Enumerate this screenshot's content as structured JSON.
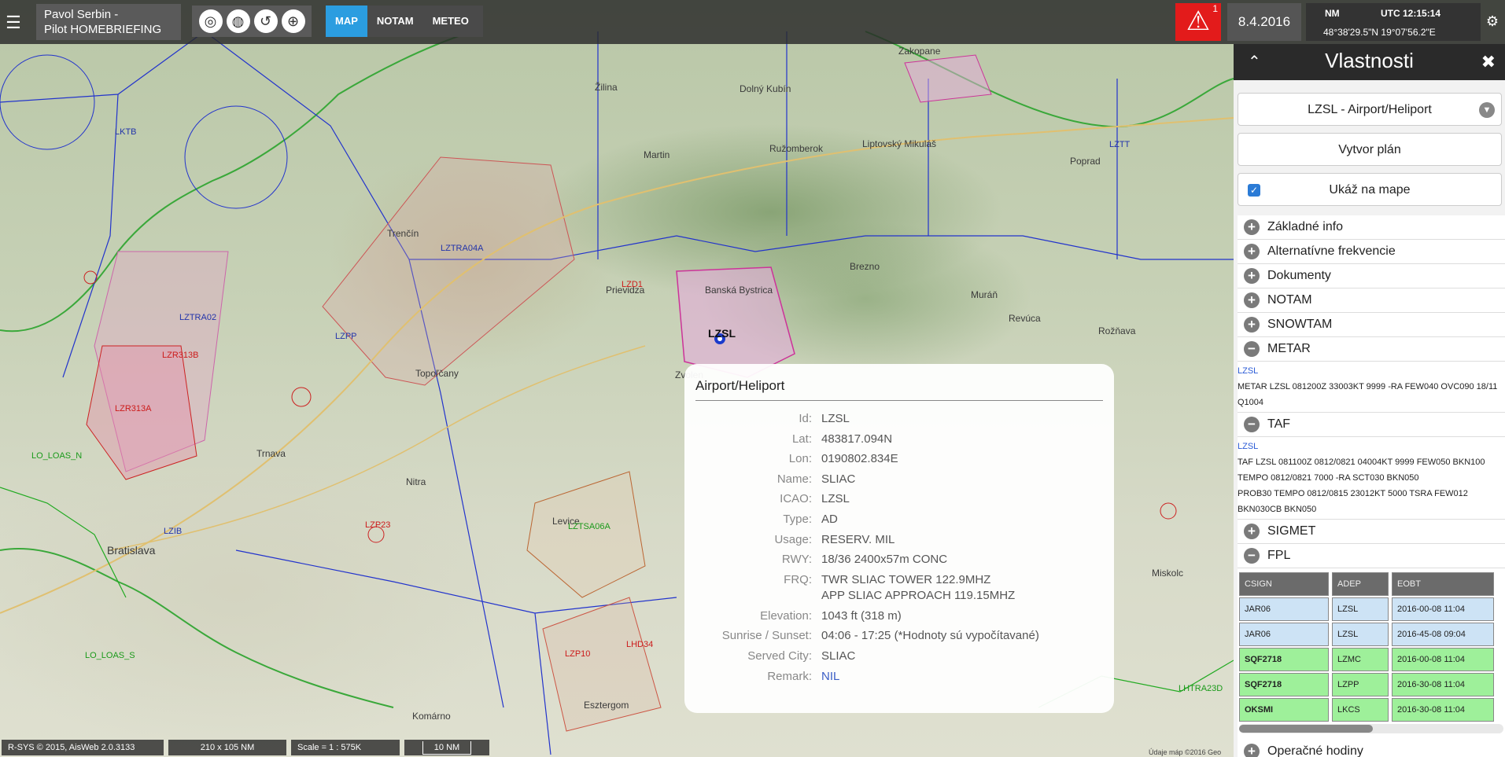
{
  "header": {
    "user_line1": "Pavol  Serbin -",
    "user_line2": "Pilot HOMEBRIEFING",
    "tool_icons": [
      "compass-icon",
      "globe-icon",
      "rotate-icon",
      "globe-grid-icon"
    ],
    "tabs": [
      {
        "label": "MAP",
        "active": true
      },
      {
        "label": "NOTAM",
        "active": false
      },
      {
        "label": "METEO",
        "active": false
      }
    ],
    "alert_count": "1",
    "date": "8.4.2016",
    "unit": "NM",
    "utc": "UTC 12:15:14",
    "latlon": "48°38'29.5\"N 19°07'56.2\"E"
  },
  "popup": {
    "title": "Airport/Heliport",
    "rows": [
      {
        "label": "Id:",
        "value": "LZSL"
      },
      {
        "label": "Lat:",
        "value": "483817.094N"
      },
      {
        "label": "Lon:",
        "value": "0190802.834E"
      },
      {
        "label": "Name:",
        "value": "SLIAC"
      },
      {
        "label": "ICAO:",
        "value": "LZSL"
      },
      {
        "label": "Type:",
        "value": "AD"
      },
      {
        "label": "Usage:",
        "value": "RESERV. MIL"
      },
      {
        "label": "RWY:",
        "value": "18/36 2400x57m CONC"
      },
      {
        "label": "FRQ:",
        "value": "TWR SLIAC TOWER 122.9MHZ",
        "value2": "APP SLIAC APPROACH 119.15MHZ"
      },
      {
        "label": "Elevation:",
        "value": "1043 ft (318 m)"
      },
      {
        "label": "Sunrise / Sunset:",
        "value": "04:06 - 17:25 (*Hodnoty sú vypočítavané)"
      },
      {
        "label": "Served City:",
        "value": "SLIAC"
      },
      {
        "label": "Remark:",
        "value": "NIL"
      }
    ]
  },
  "panel": {
    "title": "Vlastnosti",
    "airport_select": "LZSL - Airport/Heliport",
    "plan_button": "Vytvor plán",
    "show_on_map": "Ukáž na mape",
    "sections": {
      "zakladne": "Základné info",
      "alt_freq": "Alternatívne frekvencie",
      "dokumenty": "Dokumenty",
      "notam": "NOTAM",
      "snowtam": "SNOWTAM",
      "metar": "METAR",
      "taf": "TAF",
      "sigmet": "SIGMET",
      "fpl": "FPL",
      "operacne": "Operačné hodiny"
    },
    "metar": {
      "station": "LZSL",
      "line1": "METAR LZSL 081200Z 33003KT 9999 -RA FEW040 OVC090 18/11",
      "line2": "Q1004"
    },
    "taf": {
      "station": "LZSL",
      "line1": "TAF LZSL 081100Z 0812/0821 04004KT 9999 FEW050 BKN100",
      "line2": "TEMPO 0812/0821 7000 -RA SCT030 BKN050",
      "line3": "PROB30 TEMPO 0812/0815 23012KT 5000 TSRA FEW012",
      "line4": "BKN030CB BKN050"
    },
    "fpl": {
      "headers": [
        "CSIGN",
        "ADEP",
        "EOBT"
      ],
      "rows": [
        {
          "csign": "JAR06",
          "adep": "LZSL",
          "eobt": "2016-00-08 11:04",
          "color": "blue"
        },
        {
          "csign": "JAR06",
          "adep": "LZSL",
          "eobt": "2016-45-08 09:04",
          "color": "blue"
        },
        {
          "csign": "SQF2718",
          "adep": "LZMC",
          "eobt": "2016-00-08 11:04",
          "color": "green"
        },
        {
          "csign": "SQF2718",
          "adep": "LZPP",
          "eobt": "2016-30-08 11:04",
          "color": "green"
        },
        {
          "csign": "OKSMI",
          "adep": "LKCS",
          "eobt": "2016-30-08 11:04",
          "color": "green"
        }
      ]
    }
  },
  "bottom": {
    "copyright": "R-SYS © 2015, AisWeb 2.0.3133",
    "extent": "210 x 105 NM",
    "scale": "Scale = 1 : 575K",
    "scalebar": "10 NM"
  },
  "attribution": "Údaje máp ©2016 Geo",
  "map": {
    "airport_marker": "LZSL",
    "labels": [
      {
        "t": "LZSL",
        "c": "city"
      },
      {
        "t": "Banská Bystrica",
        "c": "city"
      },
      {
        "t": "Brezno",
        "c": "city"
      },
      {
        "t": "Žilina",
        "c": "city"
      },
      {
        "t": "Martin",
        "c": "city"
      },
      {
        "t": "Ružomberok",
        "c": "city"
      },
      {
        "t": "Liptovský Mikuláš",
        "c": "city"
      },
      {
        "t": "Poprad",
        "c": "city"
      },
      {
        "t": "Zakopane",
        "c": "city"
      },
      {
        "t": "Trenčín",
        "c": "city"
      },
      {
        "t": "Nitra",
        "c": "city"
      },
      {
        "t": "Bratislava",
        "c": "city"
      },
      {
        "t": "Trnava",
        "c": "city"
      },
      {
        "t": "Zvolen",
        "c": "city"
      },
      {
        "t": "Levice",
        "c": "city"
      },
      {
        "t": "Topoľčany",
        "c": "city"
      },
      {
        "t": "Prievidza",
        "c": "city"
      },
      {
        "t": "Komárno",
        "c": "city"
      },
      {
        "t": "Esztergom",
        "c": "city"
      },
      {
        "t": "Miskolc",
        "c": "city"
      },
      {
        "t": "Rožňava",
        "c": "city"
      },
      {
        "t": "Revúca",
        "c": "city"
      },
      {
        "t": "Muráň",
        "c": "city"
      },
      {
        "t": "Dolný Kubín",
        "c": "city"
      },
      {
        "t": "LZTT",
        "c": "blue"
      },
      {
        "t": "LZPP",
        "c": "blue"
      },
      {
        "t": "LZIB",
        "c": "blue"
      },
      {
        "t": "LKTB",
        "c": "blue"
      },
      {
        "t": "LZTRA04A",
        "c": "blue"
      },
      {
        "t": "LZTRA02",
        "c": "blue"
      },
      {
        "t": "LZR313B",
        "c": "red"
      },
      {
        "t": "LZR313A",
        "c": "red"
      },
      {
        "t": "LZP23",
        "c": "red"
      },
      {
        "t": "LZP10",
        "c": "red"
      },
      {
        "t": "LZD1",
        "c": "red"
      },
      {
        "t": "LHD34",
        "c": "red"
      },
      {
        "t": "LZTSA06A",
        "c": "green"
      },
      {
        "t": "LO_LOAS_N",
        "c": "green"
      },
      {
        "t": "LO_LOAS_S",
        "c": "green"
      },
      {
        "t": "LHTRA23D",
        "c": "green"
      }
    ]
  }
}
